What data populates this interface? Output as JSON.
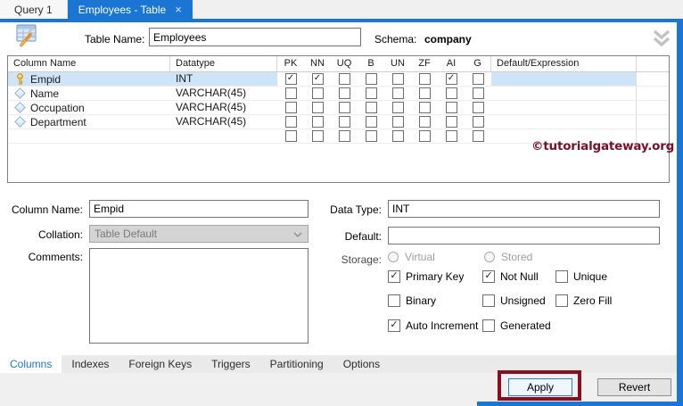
{
  "window": {
    "tabs": [
      {
        "label": "Query 1",
        "active": false,
        "closable": false
      },
      {
        "label": "Employees - Table",
        "active": true,
        "closable": true
      }
    ],
    "close_glyph": "×"
  },
  "toolbar": {
    "table_name_label": "Table Name:",
    "table_name_value": "Employees",
    "schema_label": "Schema:",
    "schema_value": "company"
  },
  "columns_grid": {
    "headers": [
      "Column Name",
      "Datatype",
      "PK",
      "NN",
      "UQ",
      "B",
      "UN",
      "ZF",
      "AI",
      "G",
      "Default/Expression"
    ],
    "rows": [
      {
        "icon": "key-icon",
        "name": "Empid",
        "datatype": "INT",
        "flags": [
          true,
          true,
          false,
          false,
          false,
          false,
          true,
          false
        ],
        "selected": true
      },
      {
        "icon": "diamond-icon",
        "name": "Name",
        "datatype": "VARCHAR(45)",
        "flags": [
          false,
          false,
          false,
          false,
          false,
          false,
          false,
          false
        ],
        "selected": false
      },
      {
        "icon": "diamond-icon",
        "name": "Occupation",
        "datatype": "VARCHAR(45)",
        "flags": [
          false,
          false,
          false,
          false,
          false,
          false,
          false,
          false
        ],
        "selected": false
      },
      {
        "icon": "diamond-icon",
        "name": "Department",
        "datatype": "VARCHAR(45)",
        "flags": [
          false,
          false,
          false,
          false,
          false,
          false,
          false,
          false
        ],
        "selected": false
      },
      {
        "icon": "",
        "name": "",
        "datatype": "",
        "flags": [
          false,
          false,
          false,
          false,
          false,
          false,
          false,
          false
        ],
        "selected": false
      }
    ]
  },
  "watermark": "©tutorialgateway.org",
  "editor": {
    "column_name": {
      "label": "Column Name:",
      "value": "Empid"
    },
    "collation": {
      "label": "Collation:",
      "value": "Table Default"
    },
    "comments": {
      "label": "Comments:",
      "value": ""
    },
    "data_type": {
      "label": "Data Type:",
      "value": "INT"
    },
    "default": {
      "label": "Default:",
      "value": ""
    },
    "storage": {
      "label": "Storage:",
      "options": [
        {
          "label": "Virtual",
          "selected": false
        },
        {
          "label": "Stored",
          "selected": false
        }
      ]
    },
    "flags": [
      {
        "label": "Primary Key",
        "checked": true
      },
      {
        "label": "Not Null",
        "checked": true
      },
      {
        "label": "Unique",
        "checked": false
      },
      {
        "label": "Binary",
        "checked": false
      },
      {
        "label": "Unsigned",
        "checked": false
      },
      {
        "label": "Zero Fill",
        "checked": false
      },
      {
        "label": "Auto Increment",
        "checked": true
      },
      {
        "label": "Generated",
        "checked": false
      }
    ]
  },
  "section_tabs": [
    {
      "label": "Columns",
      "active": true
    },
    {
      "label": "Indexes",
      "active": false
    },
    {
      "label": "Foreign Keys",
      "active": false
    },
    {
      "label": "Triggers",
      "active": false
    },
    {
      "label": "Partitioning",
      "active": false
    },
    {
      "label": "Options",
      "active": false
    }
  ],
  "actions": {
    "apply_label": "Apply",
    "revert_label": "Revert"
  },
  "colors": {
    "accent_blue": "#1a76d2",
    "selection_blue": "#cfe5f7",
    "watermark_maroon": "#7d0e26",
    "annotation_maroon": "#8b0d20"
  }
}
